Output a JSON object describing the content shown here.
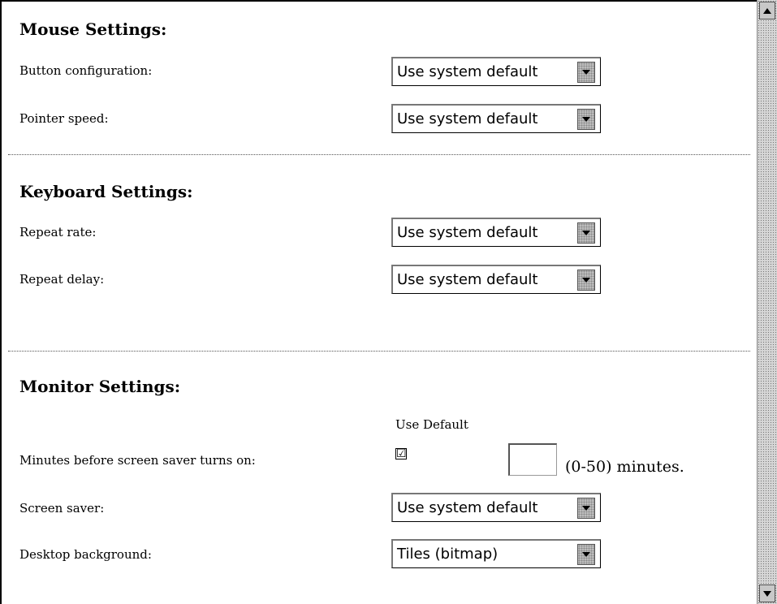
{
  "mouse": {
    "heading": "Mouse Settings:",
    "button_configuration": {
      "label": "Button configuration:",
      "value": "Use system default"
    },
    "pointer_speed": {
      "label": "Pointer speed:",
      "value": "Use system default"
    }
  },
  "keyboard": {
    "heading": "Keyboard Settings:",
    "repeat_rate": {
      "label": "Repeat rate:",
      "value": "Use system default"
    },
    "repeat_delay": {
      "label": "Repeat delay:",
      "value": "Use system default"
    }
  },
  "monitor": {
    "heading": "Monitor Settings:",
    "use_default_header": "Use Default",
    "screen_saver_minutes": {
      "label": "Minutes before screen saver turns on:",
      "use_default_checked": true,
      "check_mark": "☑",
      "value": "",
      "units": "(0-50) minutes."
    },
    "screen_saver": {
      "label": "Screen saver:",
      "value": "Use system default"
    },
    "desktop_background": {
      "label": "Desktop background:",
      "value": "Tiles (bitmap)"
    }
  },
  "icons": {
    "dropdown_arrow": "chevron-down-icon",
    "scroll_up": "scroll-up-arrow-icon",
    "scroll_down": "scroll-down-arrow-icon"
  }
}
